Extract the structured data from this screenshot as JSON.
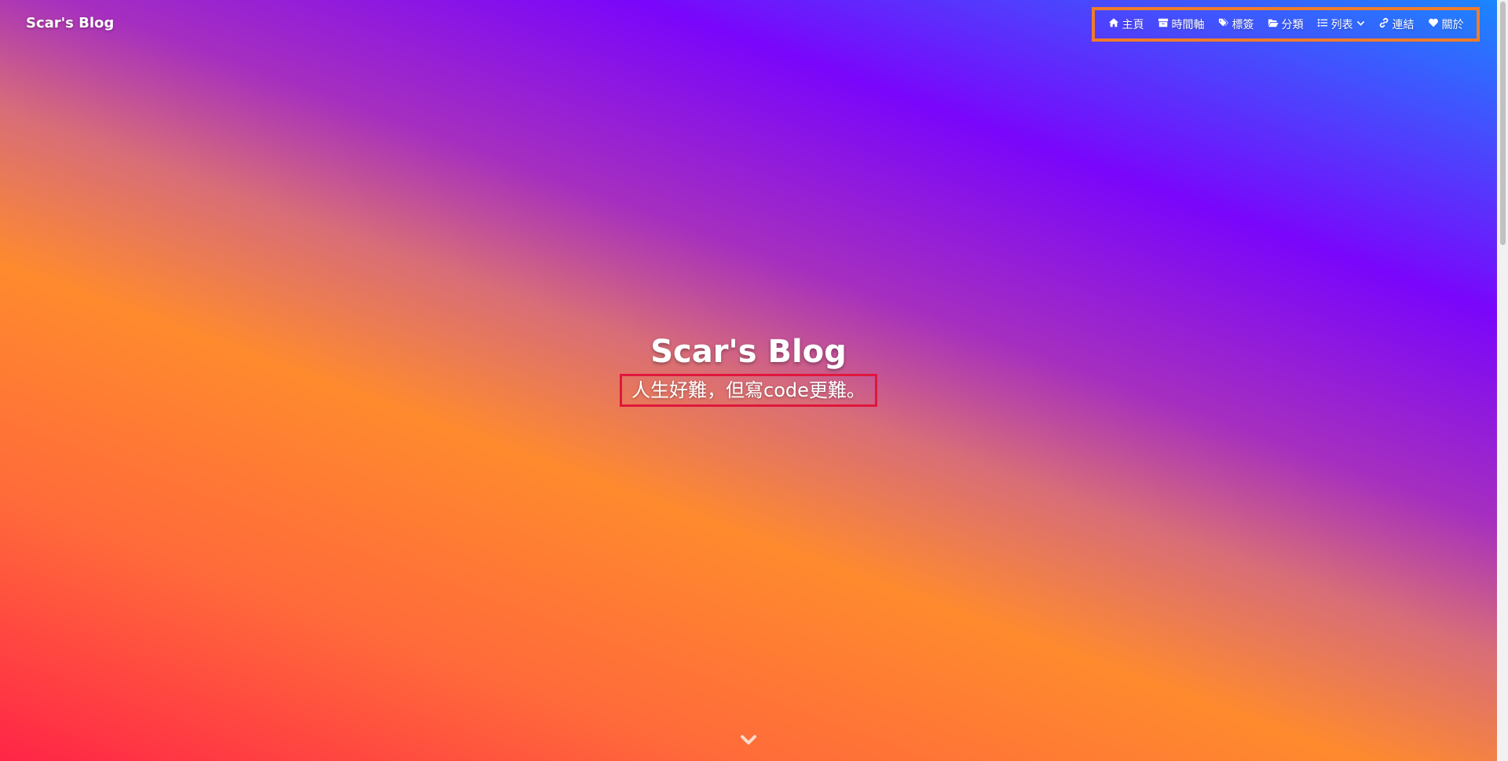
{
  "site": {
    "title": "Scar's Blog"
  },
  "nav": {
    "items": [
      {
        "label": "主頁",
        "icon": "home-icon"
      },
      {
        "label": "時間軸",
        "icon": "archive-icon"
      },
      {
        "label": "標簽",
        "icon": "tags-icon"
      },
      {
        "label": "分類",
        "icon": "folder-open-icon"
      },
      {
        "label": "列表",
        "icon": "list-icon"
      },
      {
        "label": "連結",
        "icon": "link-icon"
      },
      {
        "label": "關於",
        "icon": "heart-icon"
      }
    ]
  },
  "hero": {
    "title": "Scar's Blog",
    "subtitle": "人生好難，但寫code更難。"
  },
  "colors": {
    "nav_highlight_border": "#f07c2b",
    "subtitle_highlight_border": "#e0163c",
    "gradient_top_right": "#1b86ff",
    "gradient_purple": "#7a06fb",
    "gradient_orange": "#ff8a2e",
    "gradient_bottom_left": "#ff2547"
  }
}
